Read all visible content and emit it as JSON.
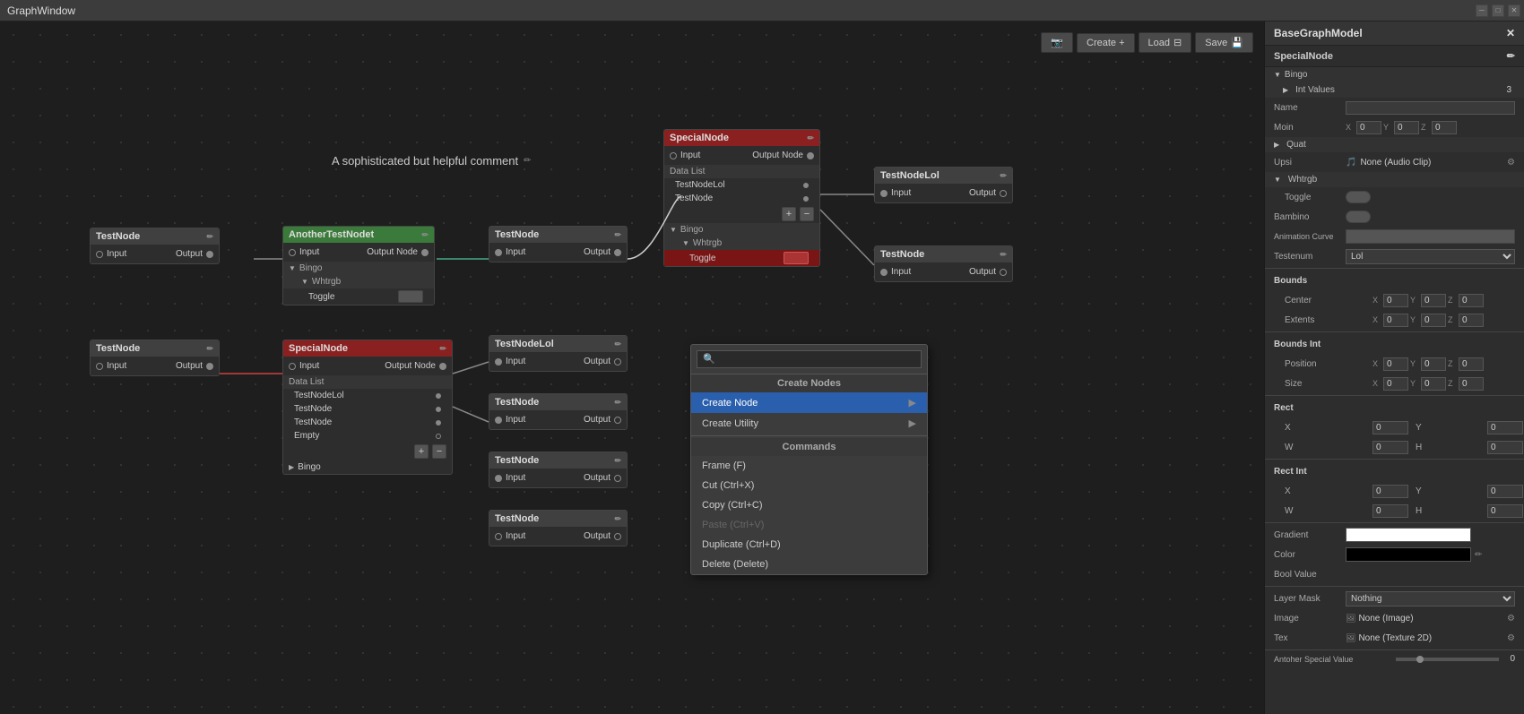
{
  "window": {
    "title": "GraphWindow",
    "controls": [
      "─",
      "□",
      "✕"
    ]
  },
  "toolbar": {
    "camera_btn": "📷",
    "create_label": "Create +",
    "load_label": "Load",
    "save_label": "Save"
  },
  "graph": {
    "comment": "A sophisticated but helpful comment",
    "nodes": [
      {
        "id": "testnode-1",
        "label": "TestNode",
        "type": "default",
        "input": "Input",
        "output": "Output"
      },
      {
        "id": "another",
        "label": "AnotherTestNodet",
        "type": "green",
        "input": "Input",
        "output": "Output Node",
        "sections": [
          {
            "name": "Bingo",
            "children": [
              {
                "name": "Whtrgb",
                "children": [
                  {
                    "name": "Toggle"
                  }
                ]
              }
            ]
          }
        ]
      },
      {
        "id": "testnode-mid",
        "label": "TestNode",
        "type": "default",
        "input": "Input",
        "output": "Output"
      },
      {
        "id": "special-top",
        "label": "SpecialNode",
        "type": "red",
        "input": "Input",
        "output": "Output Node",
        "datalist": [
          "TestNodeLol",
          "TestNode"
        ],
        "sections": [
          {
            "name": "Bingo",
            "children": [
              {
                "name": "Whtrgb",
                "children": [
                  {
                    "name": "Toggle"
                  }
                ]
              }
            ]
          }
        ]
      },
      {
        "id": "testnodelol-top",
        "label": "TestNodeLol",
        "type": "default",
        "input": "Input",
        "output": "Output"
      },
      {
        "id": "testnode-top-r",
        "label": "TestNode",
        "type": "default",
        "input": "Input",
        "output": "Output"
      },
      {
        "id": "testnode-2",
        "label": "TestNode",
        "type": "default",
        "input": "Input",
        "output": "Output"
      },
      {
        "id": "special-bot",
        "label": "SpecialNode",
        "type": "red",
        "input": "Input",
        "output": "Output Node",
        "datalist": [
          "TestNodeLol",
          "TestNode",
          "TestNode",
          "Empty"
        ]
      },
      {
        "id": "testnodelol-bot",
        "label": "TestNodeLol",
        "type": "default",
        "input": "Input",
        "output": "Output"
      },
      {
        "id": "testnode-bot1",
        "label": "TestNode",
        "type": "default",
        "input": "Input",
        "output": "Output"
      },
      {
        "id": "testnode-bot2",
        "label": "TestNode",
        "type": "default",
        "input": "Input",
        "output": "Output"
      },
      {
        "id": "testnode-bot3",
        "label": "TestNode",
        "type": "default",
        "input": "Input",
        "output": "Output"
      }
    ]
  },
  "context_menu": {
    "search_placeholder": "🔍",
    "sections": [
      {
        "header": "Create Nodes",
        "items": [
          {
            "label": "Create Node",
            "has_arrow": true,
            "active": true
          },
          {
            "label": "Create Utility",
            "has_arrow": true
          }
        ]
      },
      {
        "header": "Commands",
        "items": [
          {
            "label": "Frame (F)",
            "has_arrow": false
          },
          {
            "label": "Cut (Ctrl+X)",
            "has_arrow": false
          },
          {
            "label": "Copy (Ctrl+C)",
            "has_arrow": false
          },
          {
            "label": "Paste (Ctrl+V)",
            "has_arrow": false,
            "disabled": true
          },
          {
            "label": "Duplicate (Ctrl+D)",
            "has_arrow": false
          },
          {
            "label": "Delete (Delete)",
            "has_arrow": false
          }
        ]
      }
    ]
  },
  "right_panel": {
    "title": "BaseGraphModel",
    "node_name": "SpecialNode",
    "edit_icon": "✏",
    "sections": {
      "bingo": {
        "label": "Bingo",
        "int_values_label": "Int Values",
        "int_values_value": "3"
      },
      "properties": {
        "name_label": "Name",
        "moin_label": "Moin",
        "moin_x": "0",
        "moin_y": "0",
        "moin_z": "0",
        "quat_label": "Quat",
        "upsi_label": "Upsi",
        "upsi_value": "None (Audio Clip)",
        "upsi_icon": "🎵",
        "whtrgb_label": "Whtrgb",
        "toggle_label": "Toggle",
        "bambino_label": "Bambino",
        "animation_curve_label": "Animation Curve",
        "testenum_label": "Testenum",
        "testenum_value": "Lol",
        "bounds_label": "Bounds",
        "center_label": "Center",
        "center_x": "0",
        "center_y": "0",
        "center_z": "0",
        "extents_label": "Extents",
        "extents_x": "0",
        "extents_y": "0",
        "extents_z": "0",
        "bounds_int_label": "Bounds Int",
        "position_label": "Position",
        "position_x": "0",
        "position_y": "0",
        "position_z": "0",
        "size_label": "Size",
        "size_x": "0",
        "size_y": "0",
        "size_z": "0",
        "rect_label": "Rect",
        "rect_x": "0",
        "rect_y": "0",
        "rect_w": "0",
        "rect_h": "0",
        "rect_int_label": "Rect Int",
        "rect_int_x": "0",
        "rect_int_y": "0",
        "rect_int_w": "0",
        "rect_int_h": "0",
        "gradient_label": "Gradient",
        "color_label": "Color",
        "bool_value_label": "Bool Value",
        "layer_mask_label": "Layer Mask",
        "layer_mask_value": "Nothing",
        "image_label": "Image",
        "image_value": "None (Image)",
        "tex_label": "Tex",
        "tex_value": "None (Texture 2D)",
        "special_label": "Antoher Special Value",
        "special_value": "0"
      }
    }
  }
}
